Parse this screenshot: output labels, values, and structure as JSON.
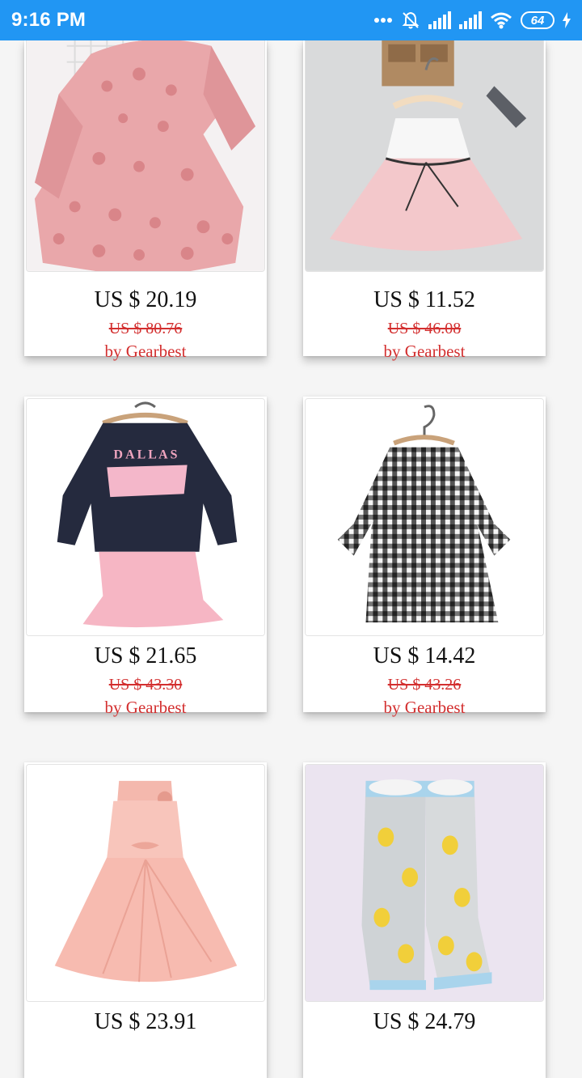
{
  "status_bar": {
    "time": "9:16 PM",
    "battery": "64",
    "icons": [
      "more-dots-icon",
      "bell-muted-icon",
      "cell-signal-icon",
      "cell-signal-icon",
      "wifi-icon",
      "battery-icon",
      "charging-bolt-icon"
    ]
  },
  "products": [
    {
      "price": "US $ 20.19",
      "old_price": "US $ 80.76",
      "seller": "by Gearbest",
      "image": "pink-lace-flower-dress"
    },
    {
      "price": "US $ 11.52",
      "old_price": "US $ 46.08",
      "seller": "by Gearbest",
      "image": "white-top-pink-tulle-dress"
    },
    {
      "price": "US $ 21.65",
      "old_price": "US $ 43.30",
      "seller": "by Gearbest",
      "image": "dallas-sweatshirt-pink-skirt-set"
    },
    {
      "price": "US $ 14.42",
      "old_price": "US $ 43.26",
      "seller": "by Gearbest",
      "image": "gingham-check-dress"
    },
    {
      "price": "US $ 23.91",
      "old_price": "",
      "seller": "",
      "image": "pink-satin-bow-dress"
    },
    {
      "price": "US $ 24.79",
      "old_price": "",
      "seller": "",
      "image": "pineapple-rain-boots"
    }
  ],
  "colors": {
    "status_bar": "#2196f3",
    "price_text": "#111111",
    "accent_red": "#d32f2f",
    "background": "#f5f5f5"
  }
}
